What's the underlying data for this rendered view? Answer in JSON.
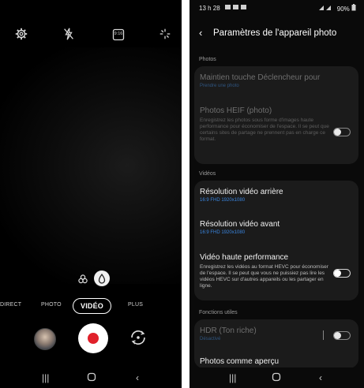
{
  "camera": {
    "top_icons": [
      "gear-icon",
      "flash-off-icon",
      "ratio-icon",
      "effects-icon"
    ],
    "ratio_label": "9:16",
    "modes": [
      "DIRECT",
      "PHOTO",
      "VIDÉO",
      "PLUS"
    ],
    "active_mode": "VIDÉO"
  },
  "settings": {
    "status_time": "13 h 28",
    "status_battery": "90%",
    "title": "Paramètres de l'appareil photo",
    "sections": {
      "photos": "Photos",
      "videos": "Vidéos",
      "utilities": "Fonctions utiles"
    },
    "items": {
      "shutter_hold": {
        "title": "Maintien touche Déclencheur pour",
        "sub": "Prendre une photo"
      },
      "heif": {
        "title": "Photos HEIF (photo)",
        "desc": "Enregistrez les photos sous forme d'images haute performance pour économiser de l'espace. Il se peut que certains sites de partage ne prennent pas en charge ce format.",
        "enabled": false
      },
      "rear_res": {
        "title": "Résolution vidéo arrière",
        "sub": "16:9 FHD 1920x1080"
      },
      "front_res": {
        "title": "Résolution vidéo avant",
        "sub": "16:9 FHD 1920x1080"
      },
      "hevc": {
        "title": "Vidéo haute performance",
        "desc": "Enregistrez les vidéos au format HEVC pour économiser de l'espace. Il se peut que vous ne puissiez pas lire les vidéos HEVC sur d'autres appareils ou les partager en ligne.",
        "enabled": false
      },
      "hdr": {
        "title": "HDR (Ton riche)",
        "sub": "Désactivé",
        "enabled": false
      },
      "preview": {
        "title": "Photos comme aperçu"
      }
    }
  },
  "colors": {
    "accent_blue": "#3a86e0",
    "record_red": "#e0202a"
  }
}
